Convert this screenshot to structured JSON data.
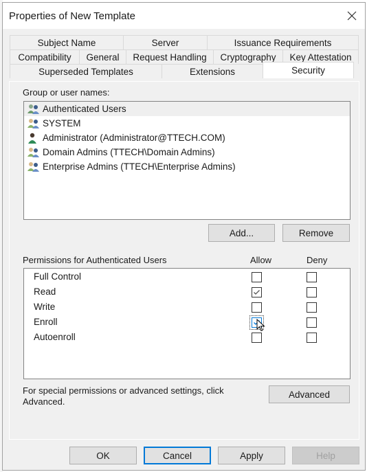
{
  "window": {
    "title": "Properties of New Template",
    "close_icon": "close-icon"
  },
  "tabs": {
    "row1": [
      {
        "label": "Subject Name"
      },
      {
        "label": "Server"
      },
      {
        "label": "Issuance Requirements"
      }
    ],
    "row2": [
      {
        "label": "Compatibility"
      },
      {
        "label": "General"
      },
      {
        "label": "Request Handling"
      },
      {
        "label": "Cryptography"
      },
      {
        "label": "Key Attestation"
      }
    ],
    "row3": [
      {
        "label": "Superseded Templates"
      },
      {
        "label": "Extensions"
      },
      {
        "label": "Security",
        "active": true
      }
    ]
  },
  "security": {
    "group_label": "Group or user names:",
    "principals": [
      {
        "name": "Authenticated Users",
        "icon": "group-icon",
        "selected": true
      },
      {
        "name": "SYSTEM",
        "icon": "group-icon"
      },
      {
        "name": "Administrator (Administrator@TTECH.COM)",
        "icon": "user-icon"
      },
      {
        "name": "Domain Admins (TTECH\\Domain Admins)",
        "icon": "group-icon"
      },
      {
        "name": "Enterprise Admins (TTECH\\Enterprise Admins)",
        "icon": "group-icon"
      }
    ],
    "add_label": "Add...",
    "remove_label": "Remove",
    "permissions_label": "Permissions for Authenticated Users",
    "allow_header": "Allow",
    "deny_header": "Deny",
    "permissions": [
      {
        "name": "Full Control",
        "allow": false,
        "deny": false
      },
      {
        "name": "Read",
        "allow": true,
        "deny": false
      },
      {
        "name": "Write",
        "allow": false,
        "deny": false
      },
      {
        "name": "Enroll",
        "allow": true,
        "deny": false,
        "focused": true
      },
      {
        "name": "Autoenroll",
        "allow": false,
        "deny": false
      }
    ],
    "advanced_text": "For special permissions or advanced settings, click Advanced.",
    "advanced_label": "Advanced"
  },
  "footer": {
    "ok_label": "OK",
    "cancel_label": "Cancel",
    "apply_label": "Apply",
    "help_label": "Help"
  },
  "colors": {
    "focus_blue": "#0078d7",
    "dialog_bg": "#f0f0f0"
  }
}
